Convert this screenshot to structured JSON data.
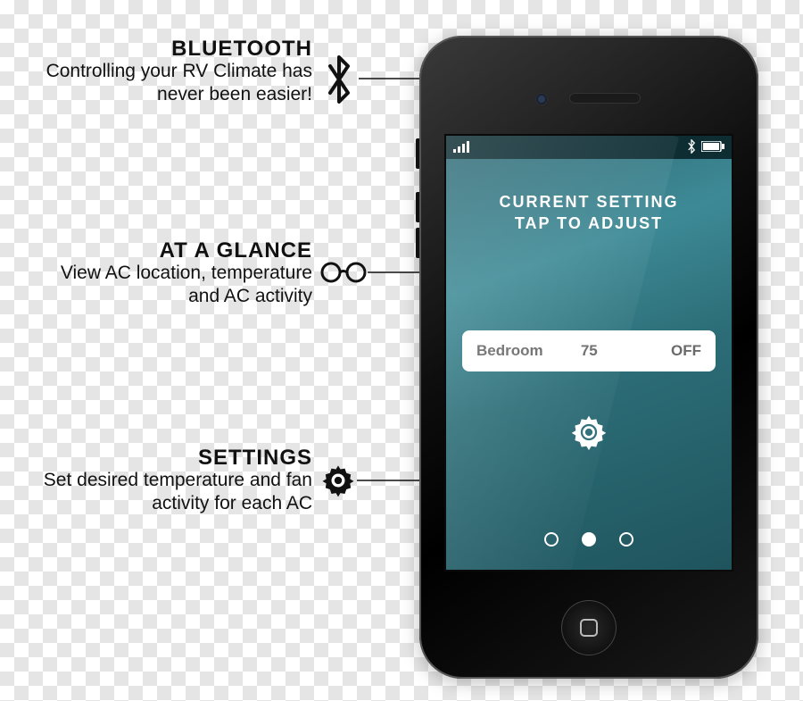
{
  "callouts": {
    "bluetooth": {
      "title": "BLUETOOTH",
      "body": "Controlling your RV Climate has never been easier!"
    },
    "glance": {
      "title": "AT A GLANCE",
      "body": "View AC location, temperature and AC activity"
    },
    "settings": {
      "title": "SETTINGS",
      "body": "Set desired temperature and fan activity for each AC"
    }
  },
  "app": {
    "heading_line1": "CURRENT SETTING",
    "heading_line2": "TAP TO ADJUST",
    "row": {
      "location": "Bedroom",
      "temperature": "75",
      "activity": "OFF"
    },
    "pager": {
      "count": 3,
      "active_index": 1
    }
  },
  "icons": {
    "bluetooth": "bluetooth-icon",
    "glasses": "glasses-icon",
    "gear": "gear-icon",
    "signal": "signal-icon",
    "battery": "battery-icon"
  },
  "colors": {
    "screen_gradient_top": "#2e6772",
    "screen_gradient_bottom": "#1f545d",
    "row_bg": "#ffffff",
    "row_text": "#6a6a6a"
  }
}
